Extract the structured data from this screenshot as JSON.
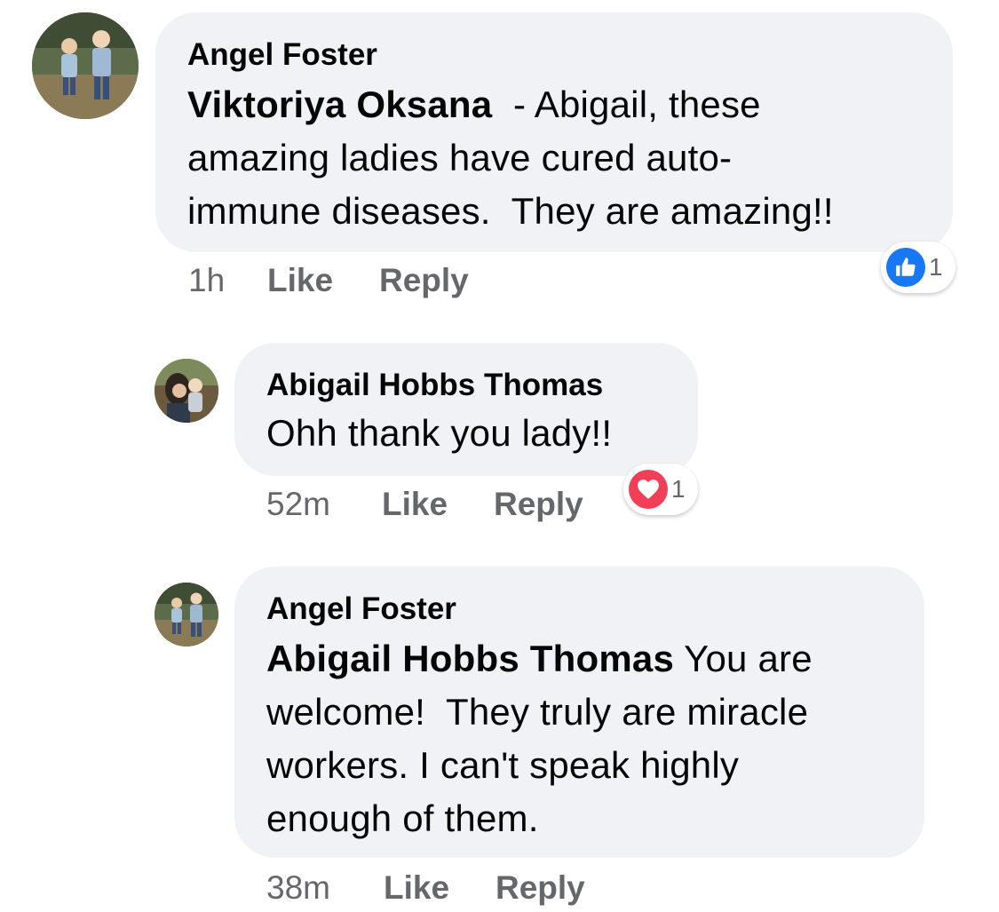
{
  "comments": [
    {
      "author": "Angel Foster",
      "mention": "Viktoriya Oksana",
      "text_lines": [
        "  - Abigail, these",
        "amazing ladies have cured auto-",
        "immune diseases.  They are amazing!!"
      ],
      "time": "1h",
      "like_label": "Like",
      "reply_label": "Reply",
      "reaction": {
        "icon": "like-icon",
        "count": "1",
        "color": "#1877f2"
      }
    },
    {
      "author": "Abigail Hobbs Thomas",
      "text_lines": [
        "Ohh thank you lady!!"
      ],
      "time": "52m",
      "like_label": "Like",
      "reply_label": "Reply",
      "reaction": {
        "icon": "love-icon",
        "count": "1",
        "color": "#f33e58"
      }
    },
    {
      "author": "Angel Foster",
      "mention": "Abigail Hobbs Thomas",
      "text_lines": [
        " You are",
        "welcome!  They truly are miracle",
        "workers. I can't speak highly",
        "enough of them."
      ],
      "time": "38m",
      "like_label": "Like",
      "reply_label": "Reply"
    }
  ]
}
